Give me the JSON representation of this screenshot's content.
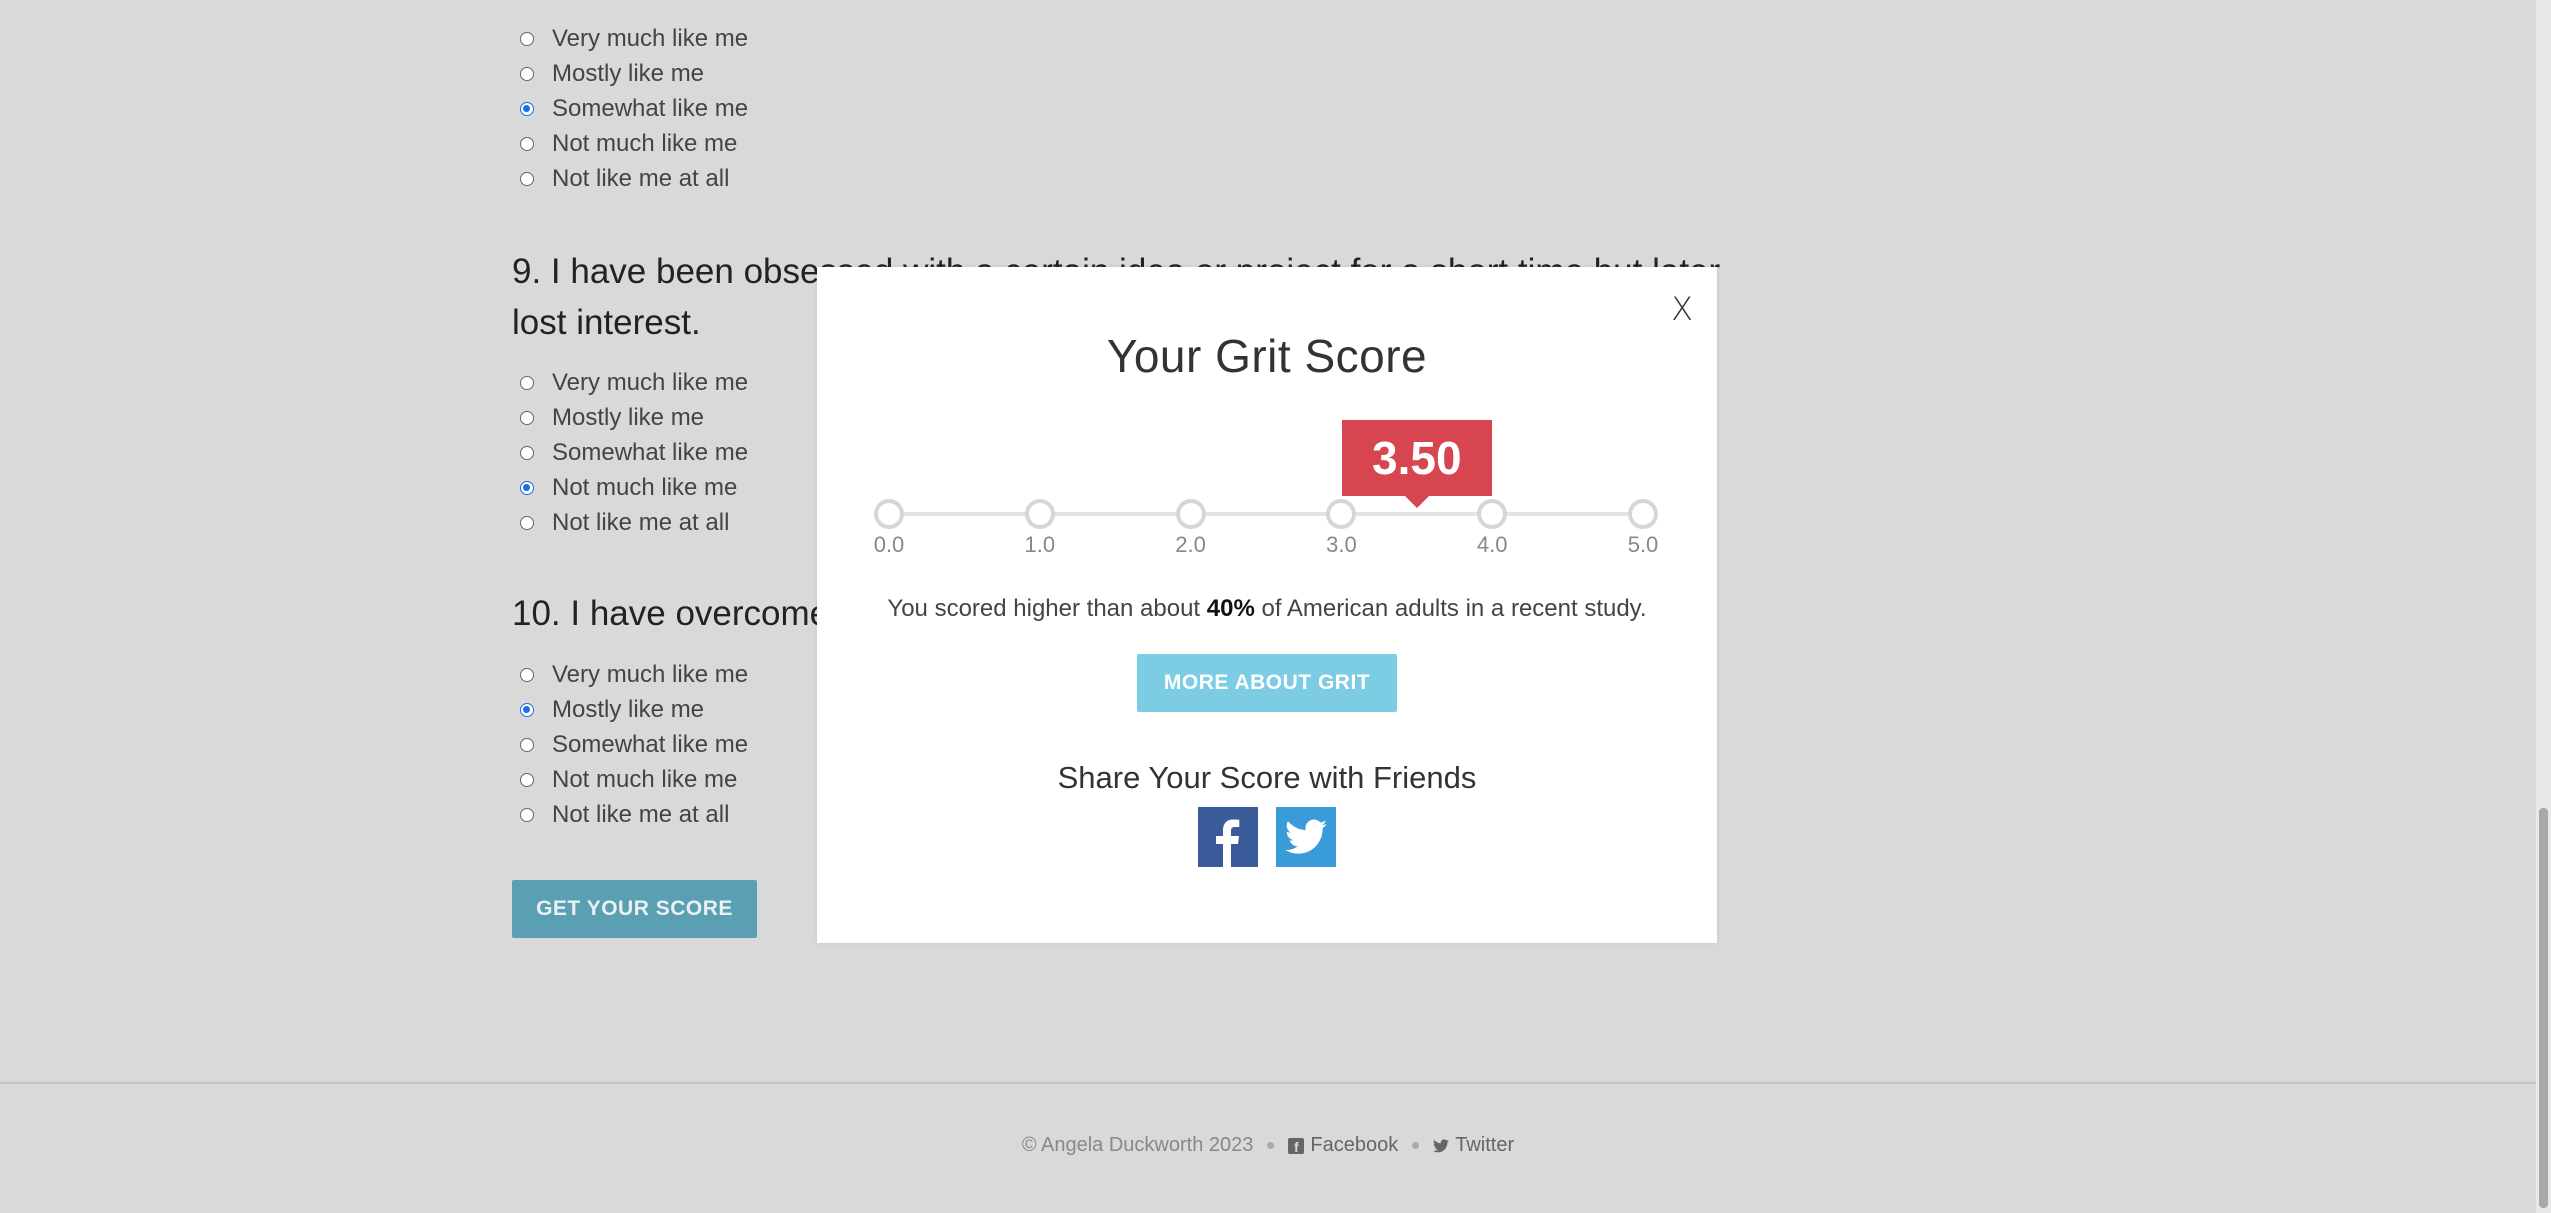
{
  "questions": [
    {
      "title": "",
      "options": [
        "Very much like me",
        "Mostly like me",
        "Somewhat like me",
        "Not much like me",
        "Not like me at all"
      ],
      "selected_index": 2
    },
    {
      "title": "9. I have been obsessed with a certain idea or project for a short time but later lost interest.",
      "options": [
        "Very much like me",
        "Mostly like me",
        "Somewhat like me",
        "Not much like me",
        "Not like me at all"
      ],
      "selected_index": 3
    },
    {
      "title": "10. I have overcome",
      "options": [
        "Very much like me",
        "Mostly like me",
        "Somewhat like me",
        "Not much like me",
        "Not like me at all"
      ],
      "selected_index": 1
    }
  ],
  "get_score_label": "GET YOUR SCORE",
  "modal": {
    "close_label": "X",
    "title": "Your Grit Score",
    "score": "3.50",
    "score_value": 3.5,
    "scale_ticks": [
      "0.0",
      "1.0",
      "2.0",
      "3.0",
      "4.0",
      "5.0"
    ],
    "result_prefix": "You scored higher than about ",
    "result_percent": "40%",
    "result_suffix": " of American adults in a recent study.",
    "more_label": "MORE ABOUT GRIT",
    "share_title": "Share Your Score with Friends",
    "share_facebook": "facebook-icon",
    "share_twitter": "twitter-icon"
  },
  "footer": {
    "copyright": "© Angela Duckworth 2023",
    "facebook_label": "Facebook",
    "twitter_label": "Twitter"
  },
  "colors": {
    "score_badge": "#d64550",
    "more_button": "#7ccce3",
    "get_score_button": "#5b9fb2",
    "facebook": "#3b5a9a",
    "twitter": "#3a9bd9",
    "radio_checked": "#1a6fe6"
  }
}
